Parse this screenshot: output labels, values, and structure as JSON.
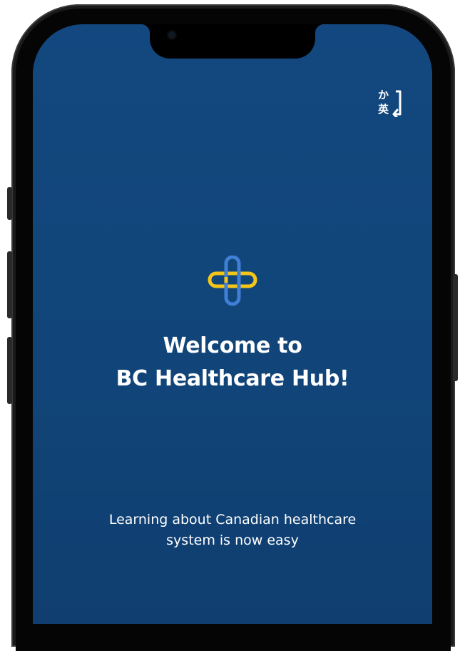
{
  "device": {
    "frame_color": "#1a1a1a",
    "screen_color": "#12487f"
  },
  "header": {
    "language_toggle": {
      "top_glyph": "か",
      "bottom_glyph": "英",
      "icon": "language-switch-icon"
    }
  },
  "logo": {
    "icon": "medical-cross-logo-icon",
    "colors": {
      "vertical": "#3f7fd6",
      "horizontal": "#f5c518"
    }
  },
  "welcome": {
    "line1": "Welcome to",
    "line2": "BC Healthcare Hub!"
  },
  "tagline": {
    "line1": "Learning about Canadian healthcare",
    "line2": "system is now easy"
  }
}
